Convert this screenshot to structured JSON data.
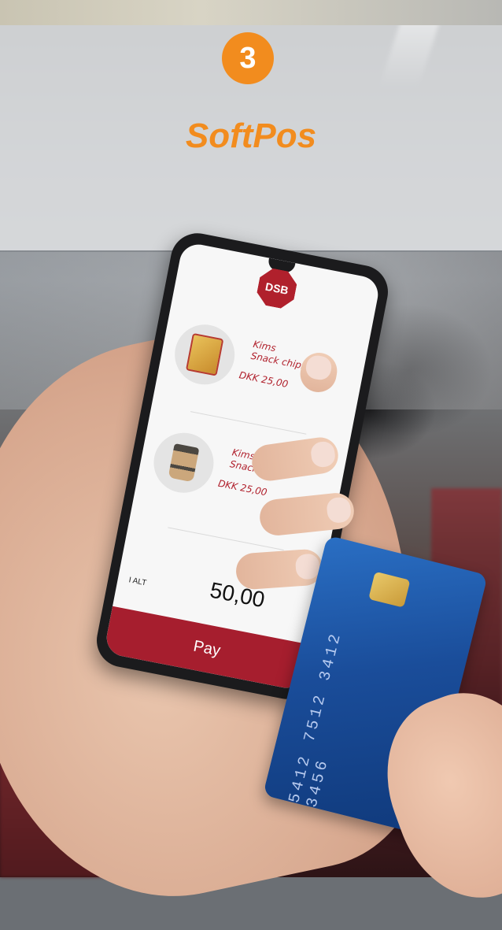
{
  "header": {
    "step_number": "3",
    "title": "SoftPos"
  },
  "phone_app": {
    "brand": "DSB",
    "products": [
      {
        "name_line1": "Kims",
        "name_line2": "Snack chips",
        "price": "DKK 25,00",
        "image": "chips-bag"
      },
      {
        "name_line1": "Kims",
        "name_line2": "Snack chips",
        "price": "DKK 25,00",
        "image": "coffee-cup"
      }
    ],
    "total_label": "I ALT",
    "total_value": "50,00",
    "pay_label": "Pay"
  },
  "colors": {
    "accent_orange": "#f28c1e",
    "brand_red": "#b0202c",
    "card_blue": "#1a4d9a"
  }
}
